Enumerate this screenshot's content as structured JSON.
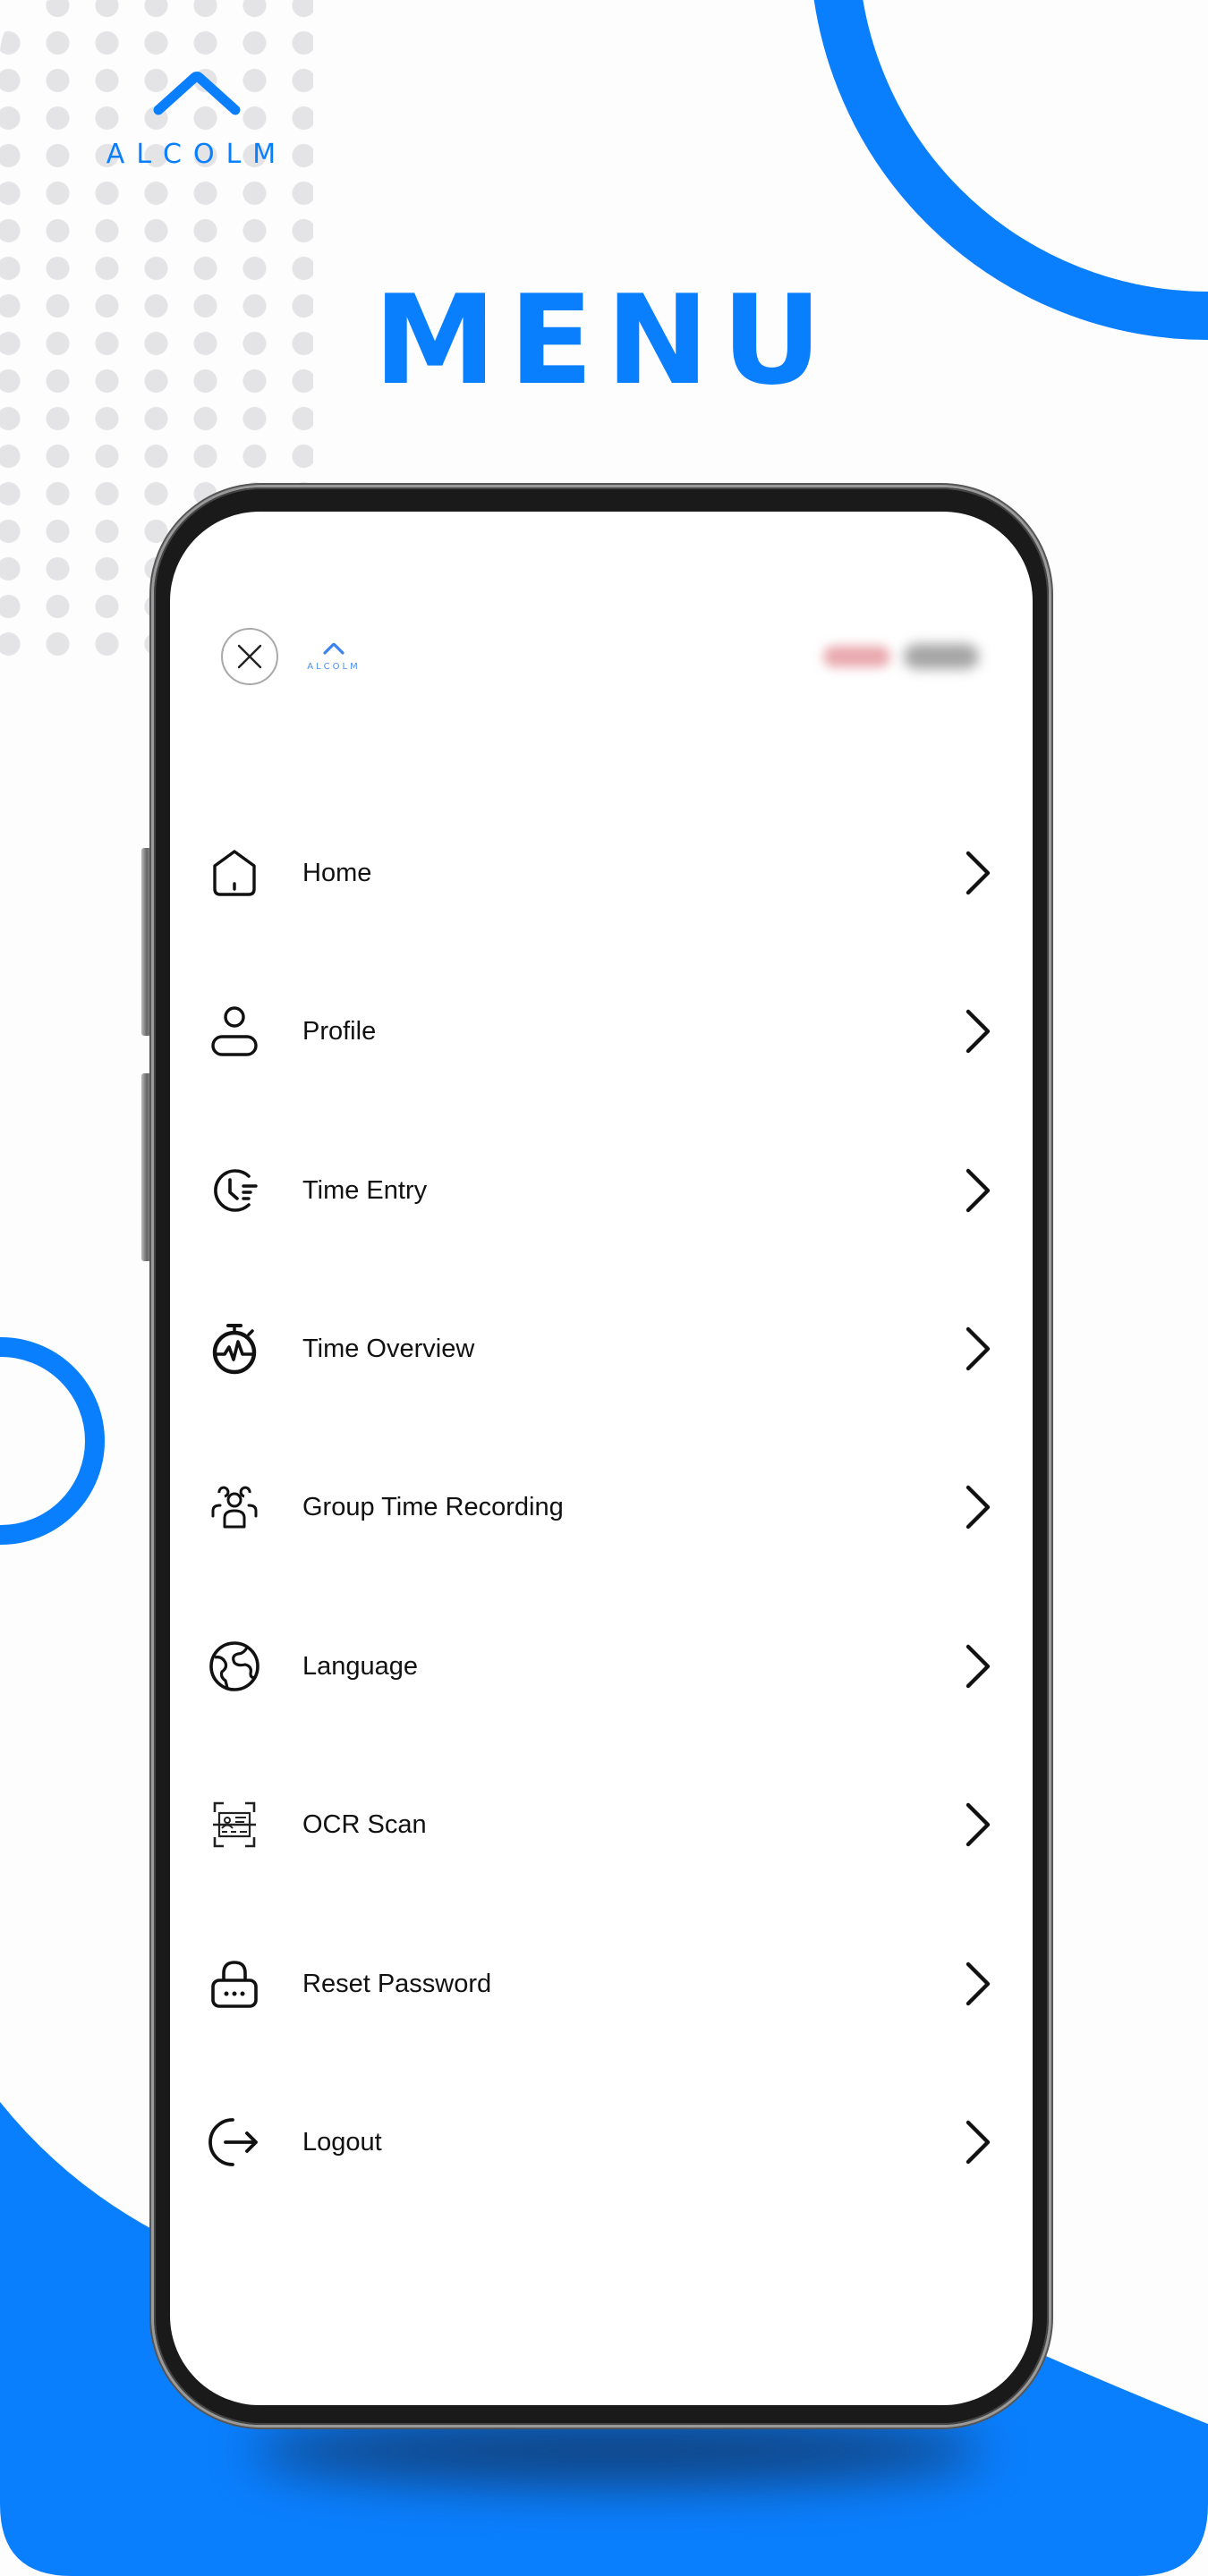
{
  "brand": {
    "name": "ALCOLM",
    "accent_color": "#0a7ffe"
  },
  "page_title": "MENU",
  "phone_header": {
    "close_icon": "close-icon",
    "logo_text": "ALCOLM",
    "user_status_blurred": "[blurred]",
    "user_name_blurred": "[blurred]"
  },
  "menu": {
    "items": [
      {
        "label": "Home",
        "icon": "home-icon"
      },
      {
        "label": "Profile",
        "icon": "user-icon"
      },
      {
        "label": "Time Entry",
        "icon": "clock-list-icon"
      },
      {
        "label": "Time Overview",
        "icon": "stopwatch-activity-icon"
      },
      {
        "label": "Group Time Recording",
        "icon": "users-group-icon"
      },
      {
        "label": "Language",
        "icon": "globe-icon"
      },
      {
        "label": "OCR Scan",
        "icon": "scan-id-card-icon"
      },
      {
        "label": "Reset Password",
        "icon": "lock-password-icon"
      },
      {
        "label": "Logout",
        "icon": "logout-icon"
      }
    ],
    "chevron_icon": "chevron-right-icon"
  }
}
